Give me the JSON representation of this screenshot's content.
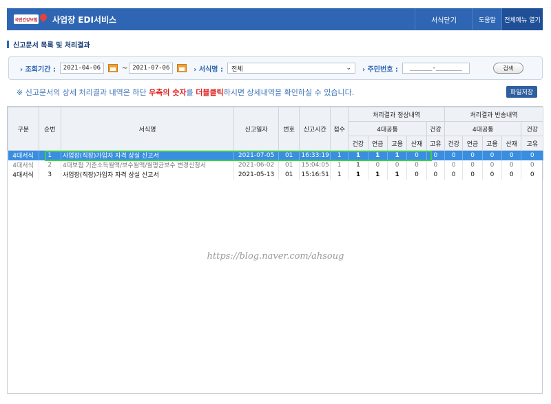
{
  "header": {
    "logo_text": "국민건강보험",
    "app_title": "사업장 EDI서비스",
    "close_form": "서식닫기",
    "help": "도움말",
    "all_menu": "전체메뉴 열기"
  },
  "section": {
    "title": "신고문서 목록 및 처리결과"
  },
  "search": {
    "period_label": "조회기간 :",
    "date_from": "2021-04-06",
    "tilde": "~",
    "date_to": "2021-07-06",
    "form_label": "서식명 :",
    "form_value": "전체",
    "ssn_label": "주민번호 :",
    "ssn_value": "______-_______",
    "search_button": "검색"
  },
  "notice": {
    "part1": "※ 신고문서의 상세 처리결과 내역은 하단 ",
    "part2": "우측의 숫자",
    "part3": "를 ",
    "part4": "더블클릭",
    "part5": "하시면 상세내역을 확인하실 수 있습니다."
  },
  "save_button": "파일저장",
  "table": {
    "headers": {
      "type": "구분",
      "seq": "순번",
      "form": "서식명",
      "date": "신고일자",
      "num": "번호",
      "time": "신고시간",
      "receipt": "접수",
      "normal_group": "처리결과 정상내역",
      "return_group": "처리결과 반송내역",
      "four_ins": "4대공통",
      "health": "건강",
      "h": "건강",
      "pension": "연금",
      "employ": "고용",
      "indus": "산재",
      "unique": "고유"
    },
    "rows": [
      {
        "type": "4대서식",
        "seq": "1",
        "form": "사업장(직장)가입자 자격 상실 신고서",
        "date": "2021-07-05",
        "num": "01",
        "time": "16:33:19",
        "receipt": "1",
        "v": [
          "1",
          "1",
          "1",
          "0",
          "0",
          "0",
          "0",
          "0",
          "0",
          "0"
        ]
      },
      {
        "type": "4대서식",
        "seq": "2",
        "form": "4대보험 기준소득월액/보수월액/월평균보수 변경신청서",
        "date": "2021-06-02",
        "num": "01",
        "time": "15:04:05",
        "receipt": "1",
        "v": [
          "1",
          "0",
          "0",
          "0",
          "0",
          "0",
          "0",
          "0",
          "0",
          "0"
        ]
      },
      {
        "type": "4대서식",
        "seq": "3",
        "form": "사업장(직장)가입자 자격 상실 신고서",
        "date": "2021-05-13",
        "num": "01",
        "time": "15:16:51",
        "receipt": "1",
        "v": [
          "1",
          "1",
          "1",
          "0",
          "0",
          "0",
          "0",
          "0",
          "0",
          "0"
        ]
      }
    ]
  },
  "watermark": "https://blog.naver.com/ahsoug"
}
